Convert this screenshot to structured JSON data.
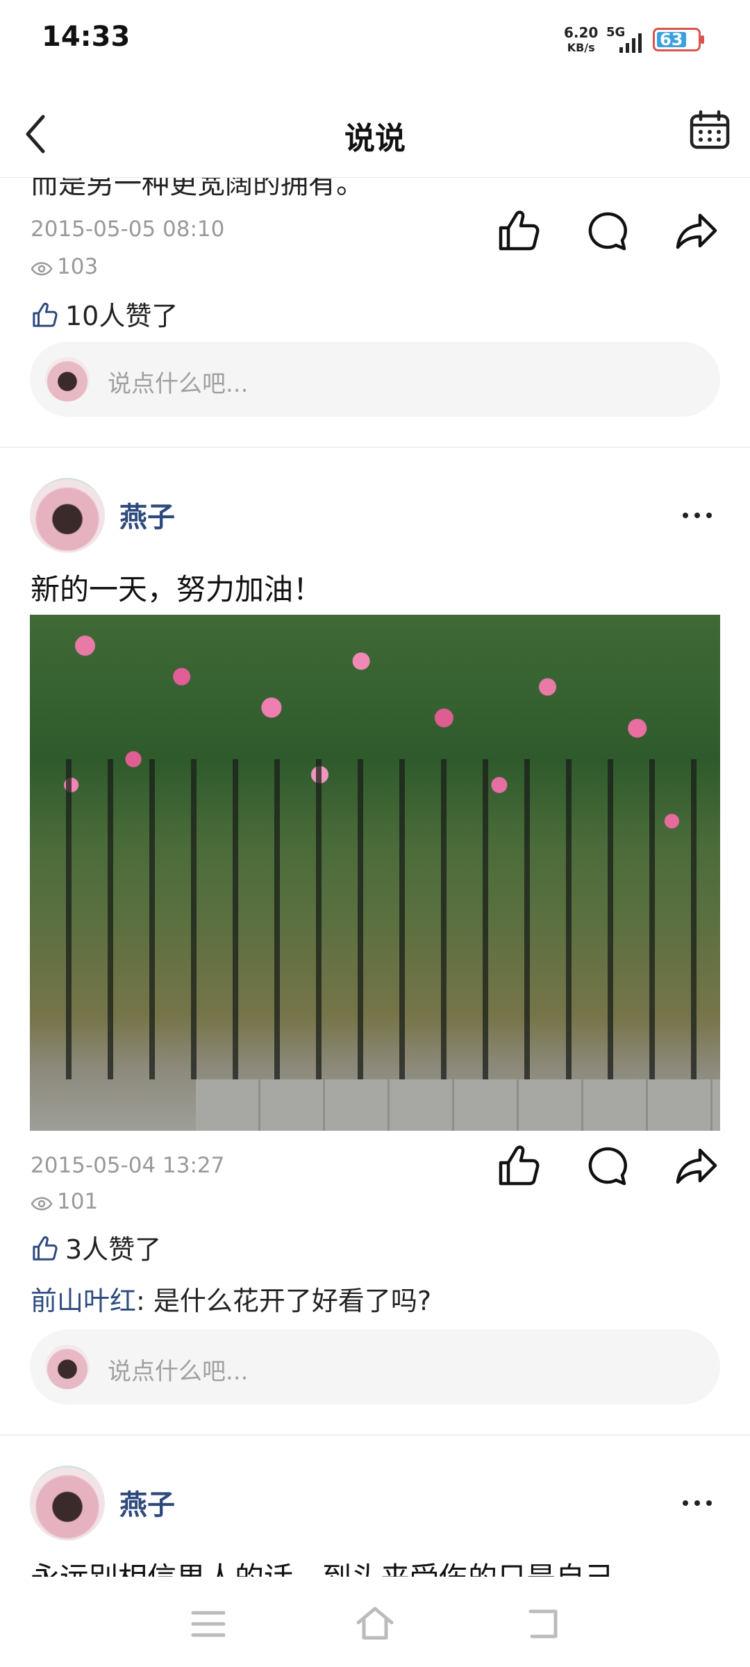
{
  "status_bar": {
    "time": "14:33",
    "net_speed_value": "6.20",
    "net_speed_unit": "KB/s",
    "network": "5G",
    "battery": "63"
  },
  "header": {
    "title": "说说",
    "back_icon": "chevron-left-icon",
    "calendar_icon": "calendar-icon"
  },
  "posts": [
    {
      "partial_text": "而是另一种更宽阔的拥有。",
      "timestamp": "2015-05-05 08:10",
      "views": "103",
      "likes": "10人赞了",
      "comment_placeholder": "说点什么吧..."
    },
    {
      "author": "燕子",
      "text": "新的一天，努力加油！",
      "timestamp": "2015-05-04 13:27",
      "views": "101",
      "likes": "3人赞了",
      "comments": [
        {
          "name": "前山叶红",
          "text": ": 是什么花开了好看了吗?"
        }
      ],
      "comment_placeholder": "说点什么吧..."
    },
    {
      "author": "燕子",
      "text": "永远别相信男人的话，到头来受伤的只是自己。"
    }
  ],
  "nav": {
    "menu_icon": "menu-icon",
    "home_icon": "home-icon",
    "back_icon": "back-icon"
  },
  "colors": {
    "author_name": "#2e4a7d",
    "timestamp": "#999999",
    "comment_box": "#f5f5f5"
  }
}
